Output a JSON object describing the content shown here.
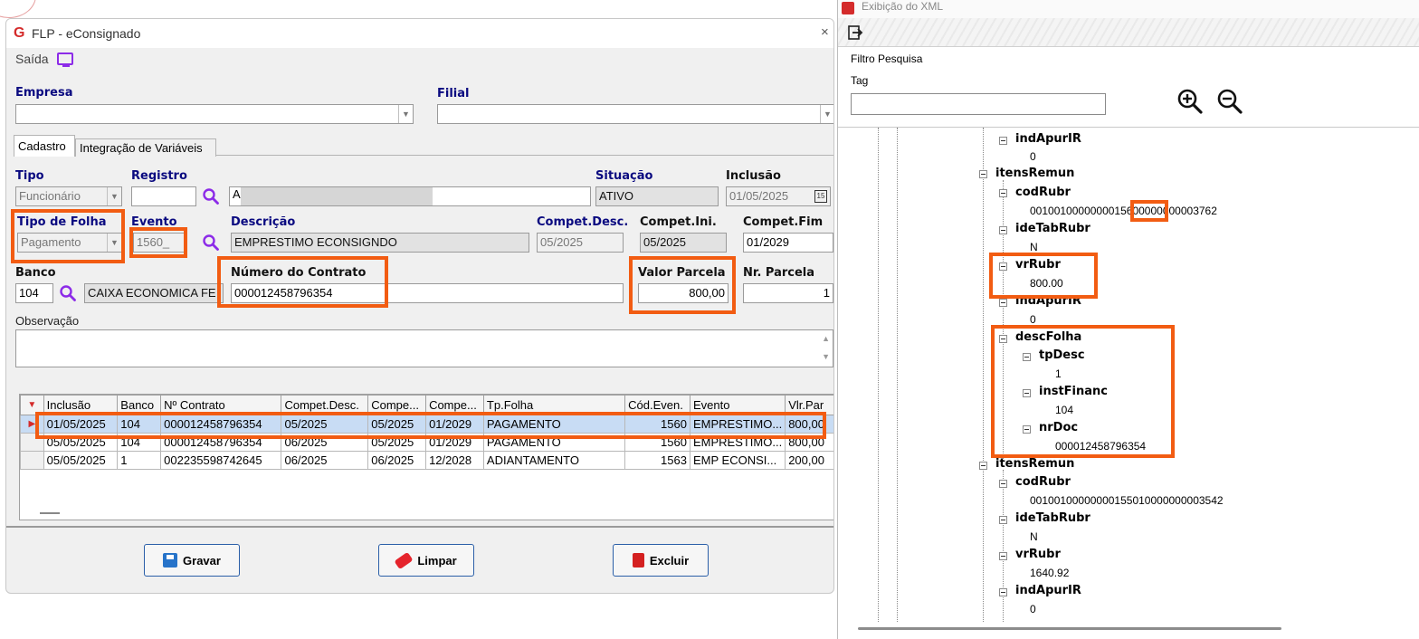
{
  "app_window": {
    "title": "FLP - eConsignado",
    "close_glyph": "×",
    "menu_saida": "Saída",
    "empresa_label": "Empresa",
    "filial_label": "Filial",
    "tabs": [
      "Cadastro",
      "Integração de Variáveis"
    ],
    "form": {
      "tipo_label": "Tipo",
      "tipo_value": "Funcionário",
      "registro_label": "Registro",
      "registro_value": "",
      "nome_value": "A",
      "situacao_label": "Situação",
      "situacao_value": "ATIVO",
      "inclusao_label": "Inclusão",
      "inclusao_value": "01/05/2025",
      "tipo_folha_label": "Tipo de Folha",
      "tipo_folha_value": "Pagamento",
      "evento_label": "Evento",
      "evento_value": "1560_",
      "descricao_label": "Descrição",
      "descricao_value": "EMPRESTIMO ECONSIGNDO",
      "compet_desc_label": "Compet.Desc.",
      "compet_desc_value": "05/2025",
      "compet_ini_label": "Compet.Ini.",
      "compet_ini_value": "05/2025",
      "compet_fim_label": "Compet.Fim",
      "compet_fim_value": "01/2029",
      "banco_label": "Banco",
      "banco_value": "104",
      "banco_nome": "CAIXA ECONOMICA FE",
      "contrato_label": "Número do Contrato",
      "contrato_value": "000012458796354",
      "valor_parcela_label": "Valor Parcela",
      "valor_parcela_value": "800,00",
      "nr_parcela_label": "Nr. Parcela",
      "nr_parcela_value": "1",
      "observacao_label": "Observação"
    },
    "grid": {
      "columns": [
        "Inclusão",
        "Banco",
        "Nº Contrato",
        "Compet.Desc.",
        "Compe...",
        "Compe...",
        "Tp.Folha",
        "Cód.Even.",
        "Evento",
        "Vlr.Par"
      ],
      "rows": [
        [
          "01/05/2025",
          "104",
          "000012458796354",
          "05/2025",
          "05/2025",
          "01/2029",
          "PAGAMENTO",
          "1560",
          "EMPRESTIMO...",
          "800,00"
        ],
        [
          "05/05/2025",
          "104",
          "000012458796354",
          "06/2025",
          "05/2025",
          "01/2029",
          "PAGAMENTO",
          "1560",
          "EMPRESTIMO...",
          "800,00"
        ],
        [
          "05/05/2025",
          "1",
          "002235598742645",
          "06/2025",
          "06/2025",
          "12/2028",
          "ADIANTAMENTO",
          "1563",
          "EMP ECONSI...",
          "200,00"
        ]
      ]
    },
    "buttons": {
      "gravar": "Gravar",
      "limpar": "Limpar",
      "excluir": "Excluir"
    }
  },
  "xml_window": {
    "title": "Exibição do XML",
    "filter_title": "Filtro Pesquisa",
    "tag_label": "Tag",
    "tag_value": "",
    "tree": {
      "n_indApurIR_1": "indApurIR",
      "v_indApurIR_1": "0",
      "n_itensRemun_1": "itensRemun",
      "n_codRubr_1": "codRubr",
      "v_codRubr_1": "0010010000000015600000000003762",
      "n_ideTabRubr_1": "ideTabRubr",
      "v_ideTabRubr_1": "N",
      "n_vrRubr_1": "vrRubr",
      "v_vrRubr_1": "800.00",
      "n_indApurIR_2": "indApurIR",
      "v_indApurIR_2": "0",
      "n_descFolha": "descFolha",
      "n_tpDesc": "tpDesc",
      "v_tpDesc": "1",
      "n_instFinanc": "instFinanc",
      "v_instFinanc": "104",
      "n_nrDoc": "nrDoc",
      "v_nrDoc": "000012458796354",
      "n_itensRemun_2": "itensRemun",
      "n_codRubr_2": "codRubr",
      "v_codRubr_2": "00100100000000155010000000003542",
      "n_ideTabRubr_2": "ideTabRubr",
      "v_ideTabRubr_2": "N",
      "n_vrRubr_2": "vrRubr",
      "v_vrRubr_2": "1640.92",
      "n_indApurIR_3": "indApurIR",
      "v_indApurIR_3": "0"
    }
  },
  "colors": {
    "highlight": "#f25c12",
    "label_blue": "#0a0a80",
    "search_purple": "#8c2be8",
    "selection": "#c8dcf4"
  }
}
